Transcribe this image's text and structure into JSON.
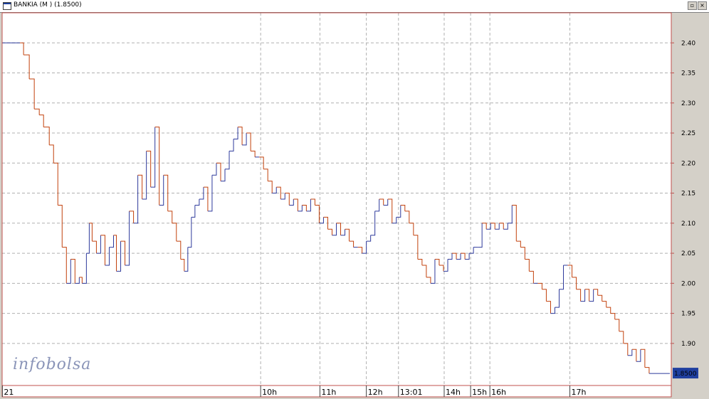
{
  "window": {
    "title": "BANKIA (M ) (1.8500)",
    "restore_glyph": "▫",
    "close_glyph": "×"
  },
  "watermark": {
    "text": "infobolsa"
  },
  "colors": {
    "plot_bg": "#ffffff",
    "frame": "#c0504d",
    "grid": "#b0b0b0",
    "line_up": "#2e3a9c",
    "line_down": "#c2410c",
    "last_price_bg": "#1f3f9f"
  },
  "chart_data": {
    "type": "line",
    "title": "BANKIA (M ) (1.8500)",
    "xlabel": "",
    "ylabel": "",
    "ylim": [
      1.83,
      2.45
    ],
    "grid": true,
    "y_axis_position": "right",
    "y_ticks": [
      2.4,
      2.35,
      2.3,
      2.25,
      2.2,
      2.15,
      2.1,
      2.05,
      2.0,
      1.95,
      1.9
    ],
    "x_tick_labels": [
      {
        "label": "21",
        "t": 0.4
      },
      {
        "label": "10h",
        "t": 362
      },
      {
        "label": "11h",
        "t": 445
      },
      {
        "label": "12h",
        "t": 510
      },
      {
        "label": "13:01",
        "t": 555
      },
      {
        "label": "14h",
        "t": 619
      },
      {
        "label": "15h",
        "t": 656
      },
      {
        "label": "16h",
        "t": 683
      },
      {
        "label": "17h",
        "t": 795
      }
    ],
    "last_price": {
      "value": 1.85,
      "label": "1.8500"
    },
    "series": [
      {
        "values": [
          [
            0,
            2.4
          ],
          [
            25,
            2.4
          ],
          [
            30,
            2.38
          ],
          [
            38,
            2.34
          ],
          [
            45,
            2.29
          ],
          [
            52,
            2.28
          ],
          [
            58,
            2.26
          ],
          [
            66,
            2.23
          ],
          [
            72,
            2.2
          ],
          [
            78,
            2.13
          ],
          [
            84,
            2.06
          ],
          [
            90,
            2.0
          ],
          [
            96,
            2.04
          ],
          [
            102,
            2.0
          ],
          [
            108,
            2.01
          ],
          [
            112,
            2.0
          ],
          [
            118,
            2.05
          ],
          [
            122,
            2.1
          ],
          [
            126,
            2.07
          ],
          [
            132,
            2.05
          ],
          [
            138,
            2.08
          ],
          [
            144,
            2.03
          ],
          [
            150,
            2.06
          ],
          [
            156,
            2.08
          ],
          [
            160,
            2.02
          ],
          [
            166,
            2.07
          ],
          [
            172,
            2.03
          ],
          [
            178,
            2.12
          ],
          [
            184,
            2.1
          ],
          [
            190,
            2.18
          ],
          [
            196,
            2.14
          ],
          [
            202,
            2.22
          ],
          [
            208,
            2.16
          ],
          [
            214,
            2.26
          ],
          [
            220,
            2.13
          ],
          [
            226,
            2.18
          ],
          [
            232,
            2.12
          ],
          [
            238,
            2.1
          ],
          [
            244,
            2.07
          ],
          [
            250,
            2.04
          ],
          [
            255,
            2.02
          ],
          [
            260,
            2.06
          ],
          [
            265,
            2.11
          ],
          [
            270,
            2.13
          ],
          [
            276,
            2.14
          ],
          [
            282,
            2.16
          ],
          [
            288,
            2.12
          ],
          [
            294,
            2.18
          ],
          [
            300,
            2.2
          ],
          [
            306,
            2.17
          ],
          [
            312,
            2.19
          ],
          [
            318,
            2.22
          ],
          [
            324,
            2.24
          ],
          [
            330,
            2.26
          ],
          [
            336,
            2.23
          ],
          [
            342,
            2.25
          ],
          [
            348,
            2.22
          ],
          [
            354,
            2.21
          ],
          [
            360,
            2.21
          ],
          [
            366,
            2.19
          ],
          [
            372,
            2.17
          ],
          [
            378,
            2.15
          ],
          [
            384,
            2.16
          ],
          [
            390,
            2.14
          ],
          [
            396,
            2.15
          ],
          [
            402,
            2.13
          ],
          [
            408,
            2.14
          ],
          [
            414,
            2.12
          ],
          [
            420,
            2.13
          ],
          [
            426,
            2.12
          ],
          [
            432,
            2.14
          ],
          [
            438,
            2.13
          ],
          [
            444,
            2.1
          ],
          [
            450,
            2.11
          ],
          [
            456,
            2.09
          ],
          [
            462,
            2.08
          ],
          [
            468,
            2.1
          ],
          [
            474,
            2.08
          ],
          [
            480,
            2.09
          ],
          [
            486,
            2.07
          ],
          [
            492,
            2.06
          ],
          [
            498,
            2.06
          ],
          [
            504,
            2.05
          ],
          [
            510,
            2.07
          ],
          [
            516,
            2.08
          ],
          [
            522,
            2.12
          ],
          [
            528,
            2.14
          ],
          [
            534,
            2.13
          ],
          [
            540,
            2.14
          ],
          [
            546,
            2.1
          ],
          [
            552,
            2.11
          ],
          [
            558,
            2.13
          ],
          [
            564,
            2.12
          ],
          [
            570,
            2.1
          ],
          [
            576,
            2.08
          ],
          [
            582,
            2.04
          ],
          [
            588,
            2.03
          ],
          [
            594,
            2.01
          ],
          [
            600,
            2.0
          ],
          [
            606,
            2.04
          ],
          [
            612,
            2.03
          ],
          [
            618,
            2.02
          ],
          [
            624,
            2.04
          ],
          [
            630,
            2.05
          ],
          [
            636,
            2.04
          ],
          [
            642,
            2.05
          ],
          [
            648,
            2.04
          ],
          [
            654,
            2.05
          ],
          [
            660,
            2.06
          ],
          [
            666,
            2.06
          ],
          [
            672,
            2.1
          ],
          [
            678,
            2.09
          ],
          [
            684,
            2.1
          ],
          [
            690,
            2.09
          ],
          [
            696,
            2.1
          ],
          [
            702,
            2.09
          ],
          [
            708,
            2.1
          ],
          [
            714,
            2.13
          ],
          [
            720,
            2.07
          ],
          [
            726,
            2.06
          ],
          [
            732,
            2.04
          ],
          [
            738,
            2.02
          ],
          [
            744,
            2.0
          ],
          [
            750,
            2.0
          ],
          [
            756,
            1.99
          ],
          [
            762,
            1.97
          ],
          [
            768,
            1.95
          ],
          [
            774,
            1.96
          ],
          [
            780,
            1.99
          ],
          [
            786,
            2.03
          ],
          [
            792,
            2.03
          ],
          [
            798,
            2.01
          ],
          [
            804,
            1.99
          ],
          [
            810,
            1.97
          ],
          [
            816,
            1.99
          ],
          [
            822,
            1.97
          ],
          [
            828,
            1.99
          ],
          [
            834,
            1.98
          ],
          [
            840,
            1.97
          ],
          [
            846,
            1.96
          ],
          [
            852,
            1.95
          ],
          [
            858,
            1.94
          ],
          [
            864,
            1.92
          ],
          [
            870,
            1.9
          ],
          [
            876,
            1.88
          ],
          [
            882,
            1.89
          ],
          [
            888,
            1.87
          ],
          [
            894,
            1.89
          ],
          [
            900,
            1.86
          ],
          [
            906,
            1.85
          ],
          [
            935,
            1.85
          ]
        ]
      }
    ]
  }
}
